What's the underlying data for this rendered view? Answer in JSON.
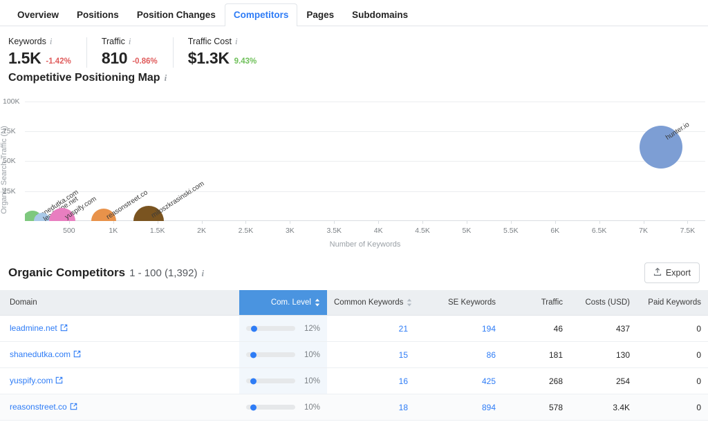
{
  "tabs": [
    {
      "label": "Overview",
      "active": false
    },
    {
      "label": "Positions",
      "active": false
    },
    {
      "label": "Position Changes",
      "active": false
    },
    {
      "label": "Competitors",
      "active": true
    },
    {
      "label": "Pages",
      "active": false
    },
    {
      "label": "Subdomains",
      "active": false
    }
  ],
  "kpis": [
    {
      "label": "Keywords",
      "value": "1.5K",
      "delta": "-1.42%",
      "delta_dir": "negative"
    },
    {
      "label": "Traffic",
      "value": "810",
      "delta": "-0.86%",
      "delta_dir": "negative"
    },
    {
      "label": "Traffic Cost",
      "value": "$1.3K",
      "delta": "9.43%",
      "delta_dir": "positive"
    }
  ],
  "chart_section": {
    "title": "Competitive Positioning Map",
    "info_icon": "info-icon"
  },
  "chart_data": {
    "type": "scatter",
    "title": "Competitive Positioning Map",
    "xlabel": "Number of Keywords",
    "ylabel": "Organic Search Traffic (N)",
    "xlim": [
      0,
      7700
    ],
    "ylim": [
      0,
      105000
    ],
    "xticks": [
      500,
      1000,
      1500,
      2000,
      2500,
      3000,
      3500,
      4000,
      4500,
      5000,
      5500,
      6000,
      6500,
      7000,
      7500
    ],
    "xtick_labels": [
      "500",
      "1K",
      "1.5K",
      "2K",
      "2.5K",
      "3K",
      "3.5K",
      "4K",
      "4.5K",
      "5K",
      "5.5K",
      "6K",
      "6.5K",
      "7K",
      "7.5K"
    ],
    "yticks": [
      25000,
      50000,
      75000,
      100000
    ],
    "ytick_labels": [
      "25K",
      "50K",
      "75K",
      "100K"
    ],
    "grid": true,
    "legend": "none",
    "points": [
      {
        "label": "shanedutka.com",
        "x": 86,
        "y": 0,
        "size": 30,
        "color": "#7ec87e"
      },
      {
        "label": "leadmine.net",
        "x": 194,
        "y": 0,
        "size": 24,
        "color": "#a9c9e8"
      },
      {
        "label": "yuspify.com",
        "x": 425,
        "y": 0,
        "size": 38,
        "color": "#e87ec0"
      },
      {
        "label": "reasonstreet.co",
        "x": 894,
        "y": 0,
        "size": 36,
        "color": "#e8924a"
      },
      {
        "label": "miloszkrasinski.com",
        "x": 1400,
        "y": 0,
        "size": 44,
        "color": "#7a5420"
      },
      {
        "label": "hunter.io",
        "x": 7200,
        "y": 62000,
        "size": 62,
        "color": "#7d9ed4"
      }
    ]
  },
  "organic_competitors": {
    "title": "Organic Competitors",
    "range": "1 - 100 (1,392)",
    "export_label": "Export",
    "export_icon": "upload-icon",
    "info_icon": "info-icon",
    "columns": [
      {
        "label": "Domain",
        "align": "left",
        "sortable": false,
        "sorted": false
      },
      {
        "label": "Com. Level",
        "align": "right",
        "sortable": true,
        "sorted": true
      },
      {
        "label": "Common Keywords",
        "align": "right",
        "sortable": true,
        "sorted": false
      },
      {
        "label": "SE Keywords",
        "align": "right",
        "sortable": false,
        "sorted": false
      },
      {
        "label": "Traffic",
        "align": "right",
        "sortable": false,
        "sorted": false
      },
      {
        "label": "Costs (USD)",
        "align": "right",
        "sortable": false,
        "sorted": false
      },
      {
        "label": "Paid Keywords",
        "align": "right",
        "sortable": false,
        "sorted": false
      }
    ],
    "rows": [
      {
        "domain": "leadmine.net",
        "com_level": "12%",
        "com_pct": 12,
        "common_keywords": "21",
        "se_keywords": "194",
        "traffic": "46",
        "costs": "437",
        "paid_keywords": "0",
        "hover": false
      },
      {
        "domain": "shanedutka.com",
        "com_level": "10%",
        "com_pct": 10,
        "common_keywords": "15",
        "se_keywords": "86",
        "traffic": "181",
        "costs": "130",
        "paid_keywords": "0",
        "hover": false
      },
      {
        "domain": "yuspify.com",
        "com_level": "10%",
        "com_pct": 10,
        "common_keywords": "16",
        "se_keywords": "425",
        "traffic": "268",
        "costs": "254",
        "paid_keywords": "0",
        "hover": false
      },
      {
        "domain": "reasonstreet.co",
        "com_level": "10%",
        "com_pct": 10,
        "common_keywords": "18",
        "se_keywords": "894",
        "traffic": "578",
        "costs": "3.4K",
        "paid_keywords": "0",
        "hover": true
      }
    ]
  },
  "colors": {
    "accent_blue": "#2e7cf6",
    "sorted_header": "#4a94e0",
    "positive": "#6fc05a",
    "negative": "#e05c5c"
  }
}
